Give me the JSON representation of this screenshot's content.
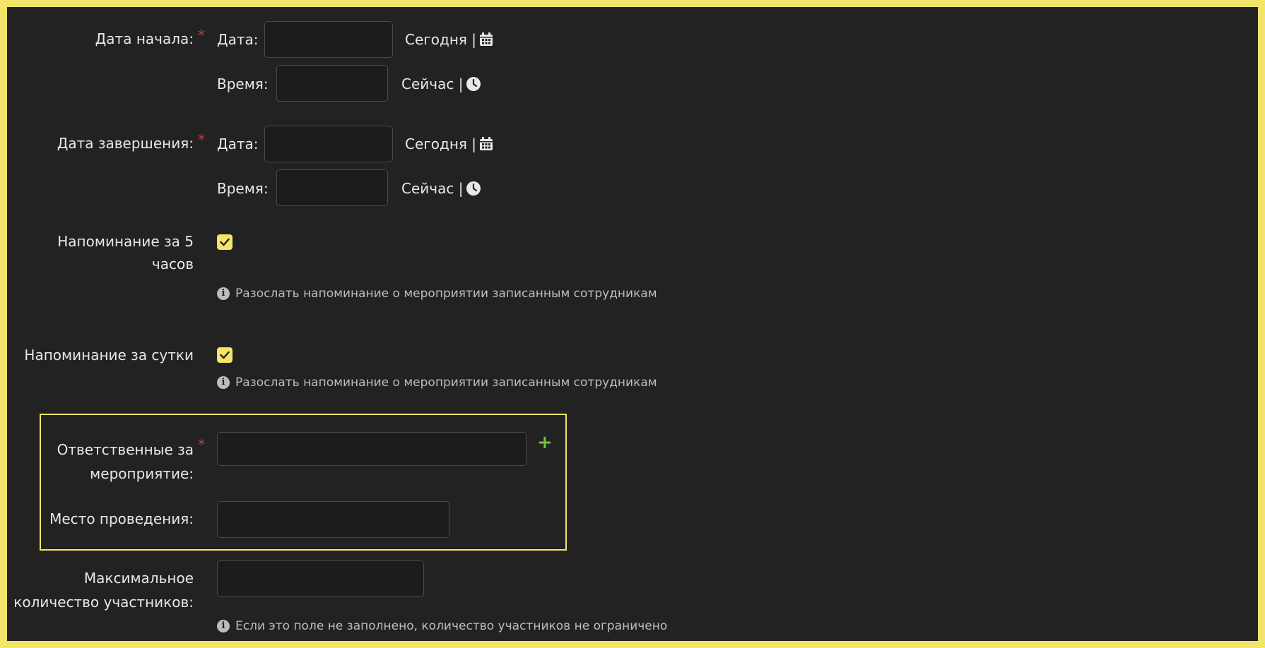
{
  "start": {
    "label": "Дата начала:",
    "date_label": "Дата:",
    "date_value": "",
    "today_label": "Сегодня |",
    "time_label": "Время:",
    "time_value": "",
    "now_label": "Сейчас |"
  },
  "end": {
    "label": "Дата завершения:",
    "date_label": "Дата:",
    "date_value": "",
    "today_label": "Сегодня |",
    "time_label": "Время:",
    "time_value": "",
    "now_label": "Сейчас |"
  },
  "reminder_5h": {
    "label_line1": "Напоминание за 5",
    "label_line2": "часов",
    "checked": true,
    "help": "Разослать напоминание о мероприятии записанным сотрудникам"
  },
  "reminder_day": {
    "label": "Напоминание за сутки",
    "checked": true,
    "help": "Разослать напоминание о мероприятии записанным сотрудникам"
  },
  "responsible": {
    "label_line1": "Ответственные за",
    "label_line2": "мероприятие:",
    "value": ""
  },
  "venue": {
    "label": "Место проведения:",
    "value": ""
  },
  "max_participants": {
    "label_line1": "Максимальное",
    "label_line2": "количество участников:",
    "value": "",
    "help": "Если это поле не заполнено, количество участников не ограничено"
  },
  "required_mark": "*",
  "info_glyph": "i",
  "plus_glyph": "+",
  "colors": {
    "accent": "#f5e46a",
    "background": "#222222",
    "required": "#e0342f",
    "add": "#6cc43a"
  }
}
